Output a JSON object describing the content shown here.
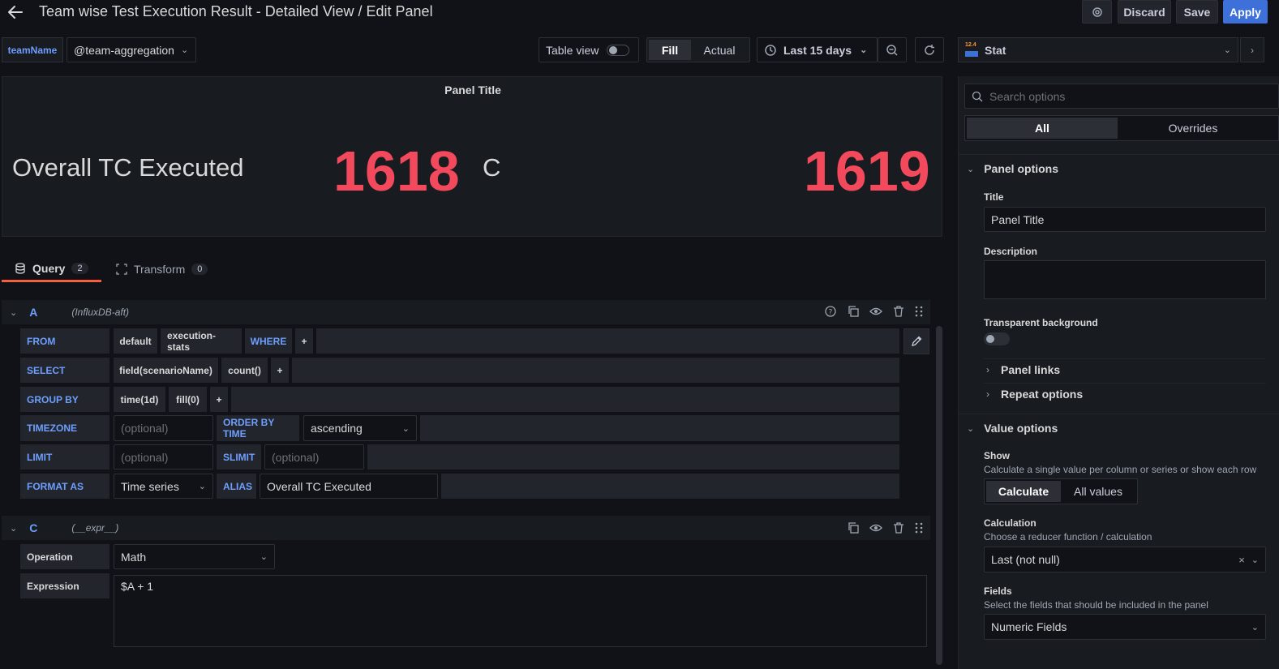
{
  "header": {
    "title": "Team wise Test Execution Result - Detailed View / Edit Panel",
    "discard_label": "Discard",
    "save_label": "Save",
    "apply_label": "Apply"
  },
  "toolbar": {
    "variable_label": "teamName",
    "variable_value": "@team-aggregation",
    "table_view_label": "Table view",
    "fill_label": "Fill",
    "actual_label": "Actual",
    "time_range": "Last 15 days"
  },
  "panel": {
    "title": "Panel Title",
    "stat_label": "Overall TC Executed",
    "value_a": "1618",
    "label_c": "C",
    "value_c": "1619"
  },
  "tabs": {
    "query_label": "Query",
    "query_count": "2",
    "transform_label": "Transform",
    "transform_count": "0"
  },
  "query_a": {
    "ref": "A",
    "datasource": "(InfluxDB-aft)",
    "from_label": "FROM",
    "from_policy": "default",
    "from_measurement": "execution-stats",
    "where_label": "WHERE",
    "plus": "+",
    "select_label": "SELECT",
    "select_field": "field(scenarioName)",
    "select_fn": "count()",
    "groupby_label": "GROUP BY",
    "groupby_time": "time(1d)",
    "groupby_fill": "fill(0)",
    "timezone_label": "TIMEZONE",
    "optional": "(optional)",
    "orderby_label": "ORDER BY TIME",
    "orderby_value": "ascending",
    "limit_label": "LIMIT",
    "slimit_label": "SLIMIT",
    "formatas_label": "FORMAT AS",
    "formatas_value": "Time series",
    "alias_label": "ALIAS",
    "alias_value": "Overall TC Executed"
  },
  "query_c": {
    "ref": "C",
    "datasource": "(__expr__)",
    "operation_label": "Operation",
    "operation_value": "Math",
    "expression_label": "Expression",
    "expression_value": "$A + 1"
  },
  "options": {
    "viz_name": "Stat",
    "viz_icon_text": "12.4",
    "search_placeholder": "Search options",
    "tab_all": "All",
    "tab_overrides": "Overrides",
    "panel_options": "Panel options",
    "title_label": "Title",
    "title_value": "Panel Title",
    "description_label": "Description",
    "transparent_label": "Transparent background",
    "panel_links": "Panel links",
    "repeat_options": "Repeat options",
    "value_options": "Value options",
    "show_label": "Show",
    "show_desc": "Calculate a single value per column or series or show each row",
    "calculate_label": "Calculate",
    "all_values_label": "All values",
    "calculation_label": "Calculation",
    "calculation_desc": "Choose a reducer function / calculation",
    "calculation_value": "Last (not null)",
    "fields_label": "Fields",
    "fields_desc": "Select the fields that should be included in the panel",
    "fields_value": "Numeric Fields"
  },
  "colors": {
    "background": "#111217",
    "panel": "#181b1f",
    "stat_red": "#f2495c",
    "accent_blue": "#3d71d9",
    "label_blue": "#6e9fff",
    "tab_underline": "#f55f3e"
  }
}
